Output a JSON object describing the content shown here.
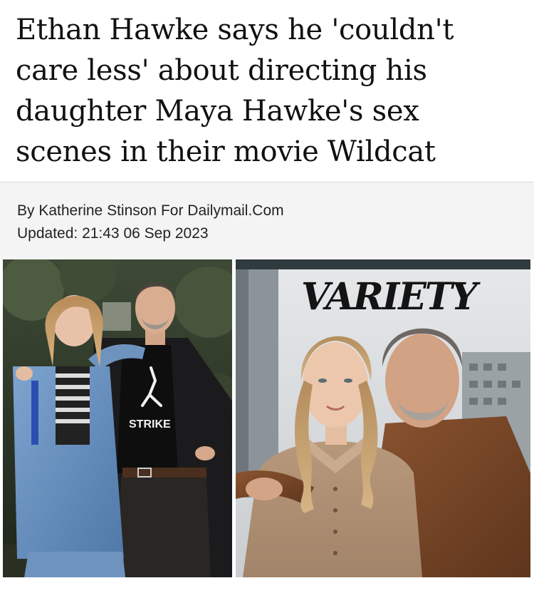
{
  "article": {
    "headline": "Ethan Hawke says he 'couldn't care less' about directing his daughter Maya Hawke's sex scenes in their movie Wildcat",
    "byline": "By Katherine Stinson For Dailymail.Com",
    "updated": "Updated: 21:43 06 Sep 2023"
  },
  "photos": {
    "left": {
      "shirt_text": "STRIKE"
    },
    "right": {
      "magazine_logo": "VARIETY"
    }
  }
}
